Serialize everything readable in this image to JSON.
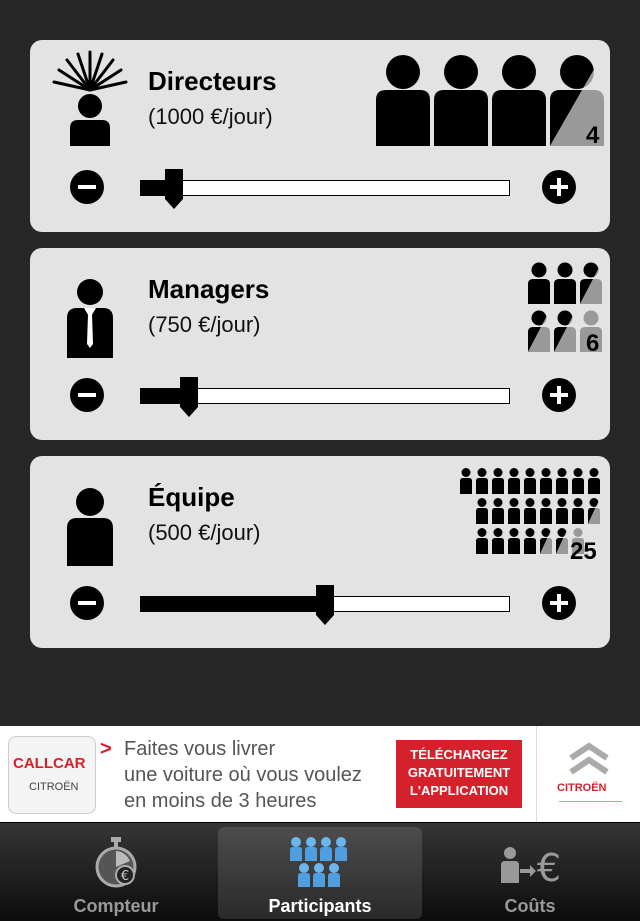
{
  "cards": [
    {
      "title": "Directeurs",
      "rate": "(1000 €/jour)",
      "count": "4",
      "count_value": 4,
      "slider_fraction": 0.09
    },
    {
      "title": "Managers",
      "rate": "(750 €/jour)",
      "count": "6",
      "count_value": 6,
      "slider_fraction": 0.13
    },
    {
      "title": "Équipe",
      "rate": "(500 €/jour)",
      "count": "25",
      "count_value": 25,
      "slider_fraction": 0.5
    }
  ],
  "ad": {
    "logo_line1": "CALLCAR",
    "logo_line2": "CITROËN",
    "arrow": ">",
    "text_line1": "Faites vous livrer",
    "text_line2": "une voiture où vous voulez",
    "text_line3": "en moins de 3 heures",
    "cta_line1": "TÉLÉCHARGEZ",
    "cta_line2": "GRATUITEMENT",
    "cta_line3": "L'APPLICATION",
    "brand": "CITROËN"
  },
  "tabs": [
    {
      "label": "Compteur",
      "icon": "stopwatch-euro-icon"
    },
    {
      "label": "Participants",
      "icon": "people-group-icon"
    },
    {
      "label": "Coûts",
      "icon": "person-arrow-euro-icon"
    }
  ],
  "active_tab": "Participants",
  "colors": {
    "accent_red": "#d4212c",
    "tab_blue": "#5aa9ea",
    "card_bg": "#e3e3e3"
  }
}
